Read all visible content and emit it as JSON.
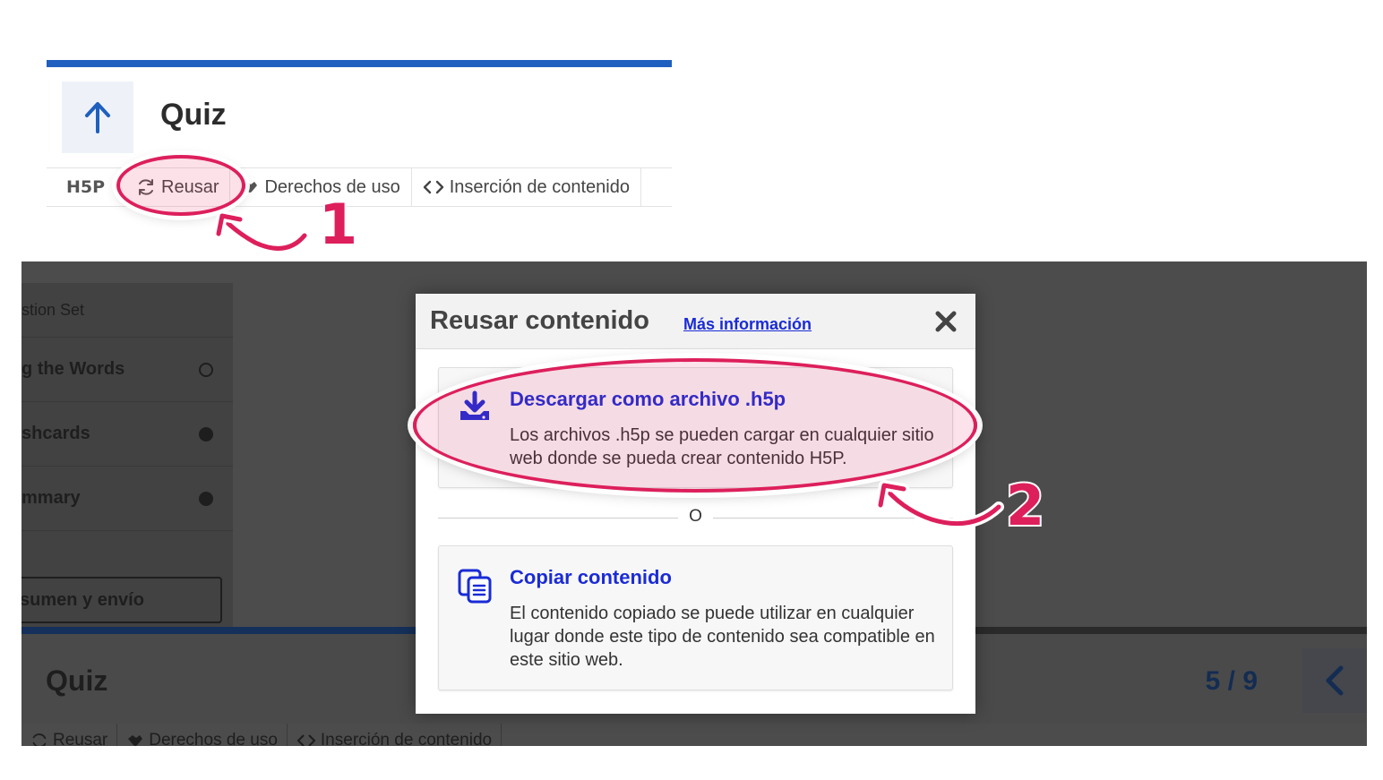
{
  "top": {
    "title": "Quiz",
    "footer": {
      "h5p_logo": "H5P",
      "reuse_label": "Reusar",
      "rights_label": "Derechos de uso",
      "embed_label": "Inserción de contenido"
    }
  },
  "annotations": {
    "step1": "1",
    "step2": "2",
    "highlight_color": "#dd1f5c"
  },
  "bottom": {
    "sidebar": {
      "items": [
        {
          "label": "stion Set",
          "status": ""
        },
        {
          "label": "g the Words",
          "status": "empty"
        },
        {
          "label": "shcards",
          "status": "filled"
        },
        {
          "label": "mmary",
          "status": "filled"
        }
      ],
      "submit_label": "sumen y envío"
    },
    "header": {
      "title": "Quiz",
      "counter": "5 / 9"
    },
    "footer": {
      "reuse_label": "Reusar",
      "rights_label": "Derechos de uso",
      "embed_label": "Inserción de contenido"
    }
  },
  "dialog": {
    "title": "Reusar contenido",
    "more_info_link": "Más información",
    "download": {
      "title": "Descargar como archivo .h5p",
      "description": "Los archivos .h5p se pueden cargar en cualquier sitio web donde se pueda crear contenido H5P."
    },
    "separator": "O",
    "copy": {
      "title": "Copiar contenido",
      "description": "El contenido copiado se puede utilizar en cualquier lugar donde este tipo de contenido sea compatible en este sitio web."
    }
  },
  "colors": {
    "brand_blue": "#1f5fbf",
    "link_blue": "#1a2bd6",
    "overlay": "#4c4c4c"
  }
}
